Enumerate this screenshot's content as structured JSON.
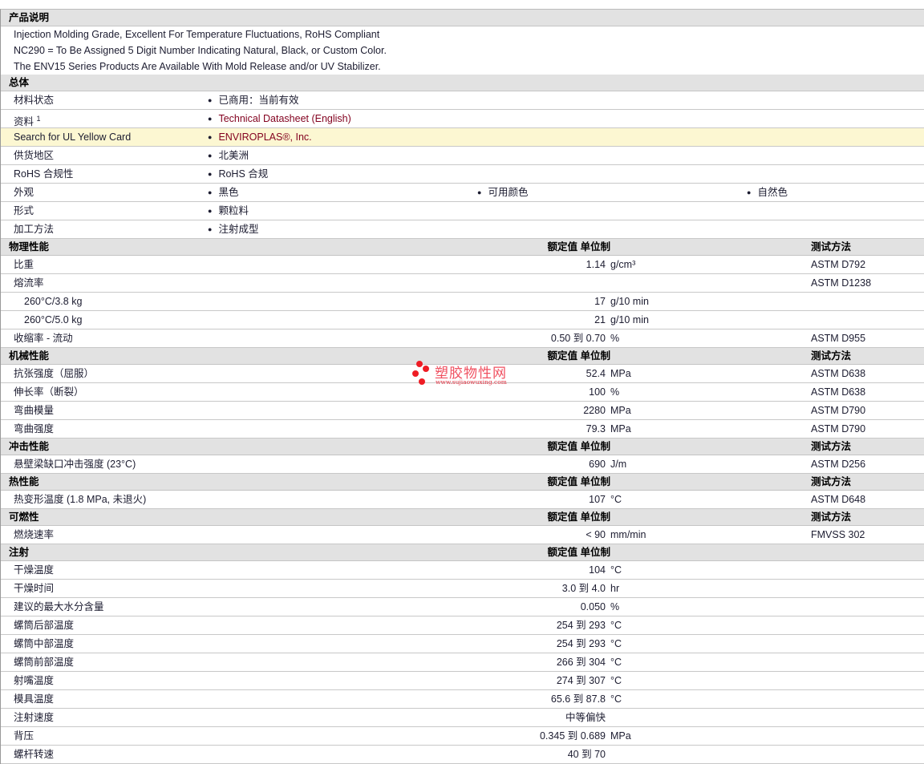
{
  "sections": [
    {
      "title": "产品说明",
      "kind": "desc",
      "lines": [
        "Injection Molding Grade, Excellent For Temperature Fluctuations, RoHS Compliant",
        "NC290 = To Be Assigned 5 Digit Number Indicating Natural, Black, or Custom Color.",
        "The ENV15 Series Products Are Available With Mold Release and/or UV Stabilizer."
      ]
    },
    {
      "title": "总体",
      "kind": "kv",
      "rows": [
        {
          "label": "材料状态",
          "items": [
            "已商用：当前有效"
          ]
        },
        {
          "label": "资料",
          "sup": "1",
          "items": [
            "Technical Datasheet (English)"
          ],
          "link": true
        },
        {
          "label": "Search for UL Yellow Card",
          "items": [
            "ENVIROPLAS®, Inc."
          ],
          "link": true,
          "highlight": true
        },
        {
          "label": "供货地区",
          "items": [
            "北美洲"
          ]
        },
        {
          "label": "RoHS 合规性",
          "items": [
            "RoHS 合规"
          ]
        },
        {
          "label": "外观",
          "items": [
            "黑色",
            "可用颜色",
            "自然色"
          ]
        },
        {
          "label": "形式",
          "items": [
            "颗粒料"
          ]
        },
        {
          "label": "加工方法",
          "items": [
            "注射成型"
          ]
        }
      ]
    },
    {
      "title": "物理性能",
      "kind": "prop",
      "h1": "额定值 单位制",
      "h2": "测试方法",
      "rows": [
        {
          "label": "比重",
          "value": "1.14",
          "unit": "g/cm³",
          "method": "ASTM D792"
        },
        {
          "label": "熔流率",
          "value": "",
          "unit": "",
          "method": "ASTM D1238"
        },
        {
          "label": "260°C/3.8 kg",
          "indent": true,
          "value": "17",
          "unit": "g/10 min",
          "method": ""
        },
        {
          "label": "260°C/5.0 kg",
          "indent": true,
          "value": "21",
          "unit": "g/10 min",
          "method": ""
        },
        {
          "label": "收缩率 - 流动",
          "value": "0.50 到  0.70",
          "unit": "%",
          "method": "ASTM D955"
        }
      ]
    },
    {
      "title": "机械性能",
      "kind": "prop",
      "h1": "额定值 单位制",
      "h2": "测试方法",
      "rows": [
        {
          "label": "抗张强度（屈服）",
          "value": "52.4",
          "unit": "MPa",
          "method": "ASTM D638"
        },
        {
          "label": "伸长率（断裂）",
          "value": "100",
          "unit": "%",
          "method": "ASTM D638"
        },
        {
          "label": "弯曲模量",
          "value": "2280",
          "unit": "MPa",
          "method": "ASTM D790"
        },
        {
          "label": "弯曲强度",
          "value": "79.3",
          "unit": "MPa",
          "method": "ASTM D790"
        }
      ]
    },
    {
      "title": "冲击性能",
      "kind": "prop",
      "h1": "额定值 单位制",
      "h2": "测试方法",
      "rows": [
        {
          "label": "悬壁梁缺口冲击强度 (23°C)",
          "value": "690",
          "unit": "J/m",
          "method": "ASTM D256"
        }
      ]
    },
    {
      "title": "热性能",
      "kind": "prop",
      "h1": "额定值 单位制",
      "h2": "测试方法",
      "rows": [
        {
          "label": "热变形温度 (1.8 MPa, 未退火)",
          "value": "107",
          "unit": "°C",
          "method": "ASTM D648"
        }
      ]
    },
    {
      "title": "可燃性",
      "kind": "prop",
      "h1": "额定值 单位制",
      "h2": "测试方法",
      "rows": [
        {
          "label": "燃烧速率",
          "value": "< 90",
          "unit": "mm/min",
          "method": "FMVSS 302"
        }
      ]
    },
    {
      "title": "注射",
      "kind": "prop",
      "h1": "额定值 单位制",
      "h2": "",
      "rows": [
        {
          "label": "干燥温度",
          "value": "104",
          "unit": "°C",
          "method": ""
        },
        {
          "label": "干燥时间",
          "value": "3.0 到  4.0",
          "unit": "hr",
          "method": ""
        },
        {
          "label": "建议的最大水分含量",
          "value": "0.050",
          "unit": "%",
          "method": ""
        },
        {
          "label": "螺筒后部温度",
          "value": "254 到  293",
          "unit": "°C",
          "method": ""
        },
        {
          "label": "螺筒中部温度",
          "value": "254 到  293",
          "unit": "°C",
          "method": ""
        },
        {
          "label": "螺筒前部温度",
          "value": "266 到  304",
          "unit": "°C",
          "method": ""
        },
        {
          "label": "射嘴温度",
          "value": "274 到  307",
          "unit": "°C",
          "method": ""
        },
        {
          "label": "模具温度",
          "value": "65.6 到  87.8",
          "unit": "°C",
          "method": ""
        },
        {
          "label": "注射速度",
          "value": "中等偏快",
          "unit": "",
          "method": ""
        },
        {
          "label": "背压",
          "value": "0.345 到  0.689",
          "unit": "MPa",
          "method": ""
        },
        {
          "label": "螺杆转速",
          "value": "40 到  70",
          "unit": "",
          "method": ""
        }
      ]
    }
  ],
  "watermark": {
    "name": "塑胶物性网",
    "url": "www.sujiaowuxing.com"
  }
}
